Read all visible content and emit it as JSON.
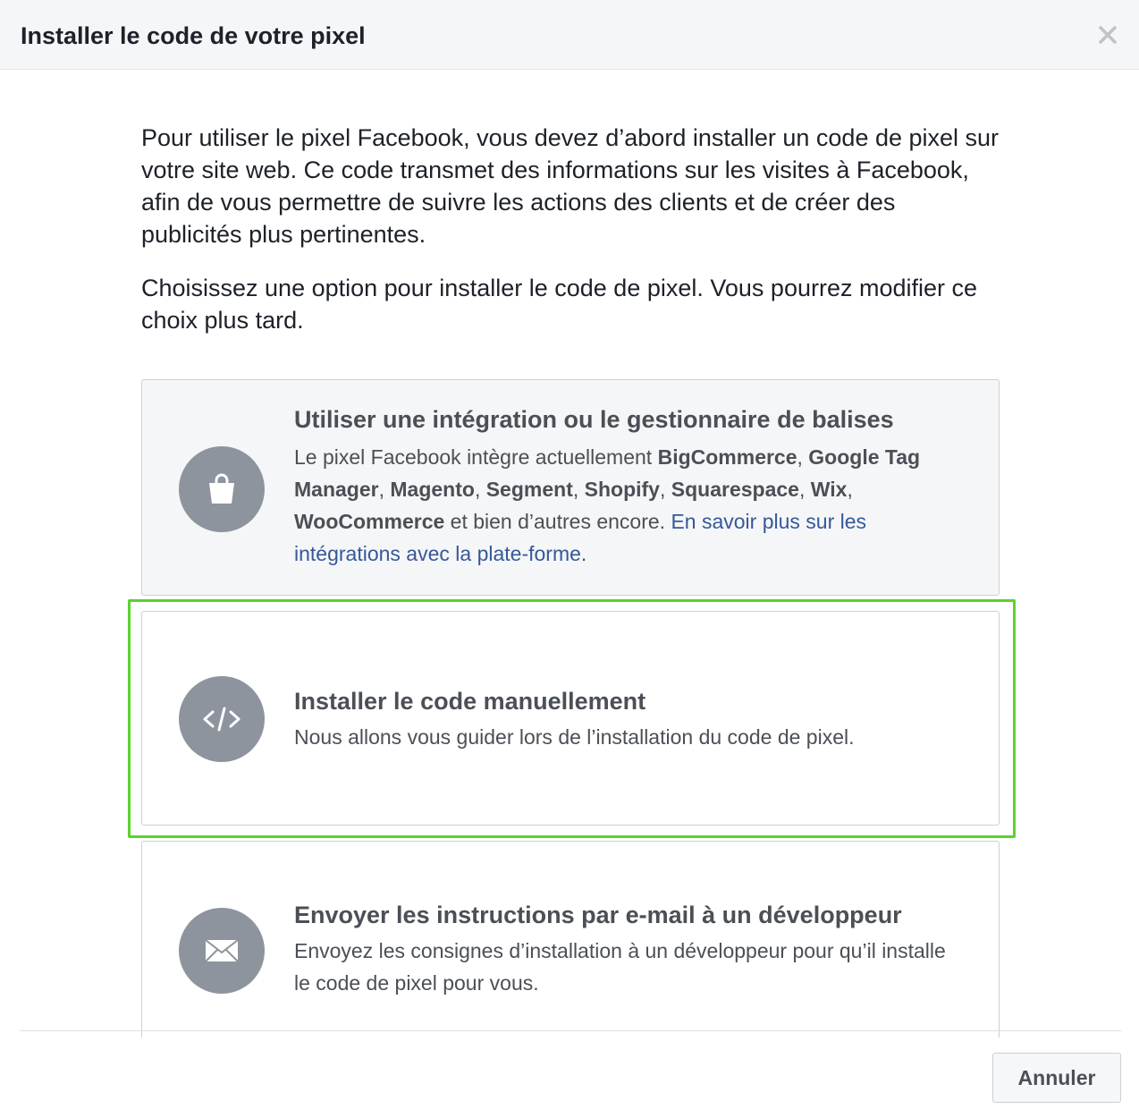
{
  "dialog": {
    "title": "Installer le code de votre pixel",
    "close_icon": "close-icon"
  },
  "intro": {
    "paragraph1": "Pour utiliser le pixel Facebook, vous devez d’abord installer un code de pixel sur votre site web. Ce code transmet des informations sur les visites à Facebook, afin de vous permettre de suivre les actions des clients et de créer des publicités plus pertinentes.",
    "paragraph2": "Choisissez une option pour installer le code de pixel. Vous pourrez modifier ce choix plus tard."
  },
  "options": [
    {
      "icon": "shopping-bag-icon",
      "title": "Utiliser une intégration ou le gestionnaire de balises",
      "desc_prefix": "Le pixel Facebook intègre actuellement ",
      "partners": [
        "BigCommerce",
        "Google Tag Manager",
        "Magento",
        "Segment",
        "Shopify",
        "Squarespace",
        "Wix",
        "WooCommerce"
      ],
      "separator": ", ",
      "desc_suffix": " et bien d’autres encore. ",
      "link": "En savoir plus sur les intégrations avec la plate-forme",
      "end": "."
    },
    {
      "icon": "code-icon",
      "title": "Installer le code manuellement",
      "desc": "Nous allons vous guider lors de l’installation du code de pixel."
    },
    {
      "icon": "envelope-icon",
      "title": "Envoyer les instructions par e-mail à un développeur",
      "desc": "Envoyez les consignes d’installation à un développeur pour qu’il installe le code de pixel pour vous."
    }
  ],
  "footer": {
    "cancel_label": "Annuler"
  },
  "colors": {
    "highlight": "#5ad32f",
    "link": "#365899",
    "icon_circle": "#8d949e"
  }
}
